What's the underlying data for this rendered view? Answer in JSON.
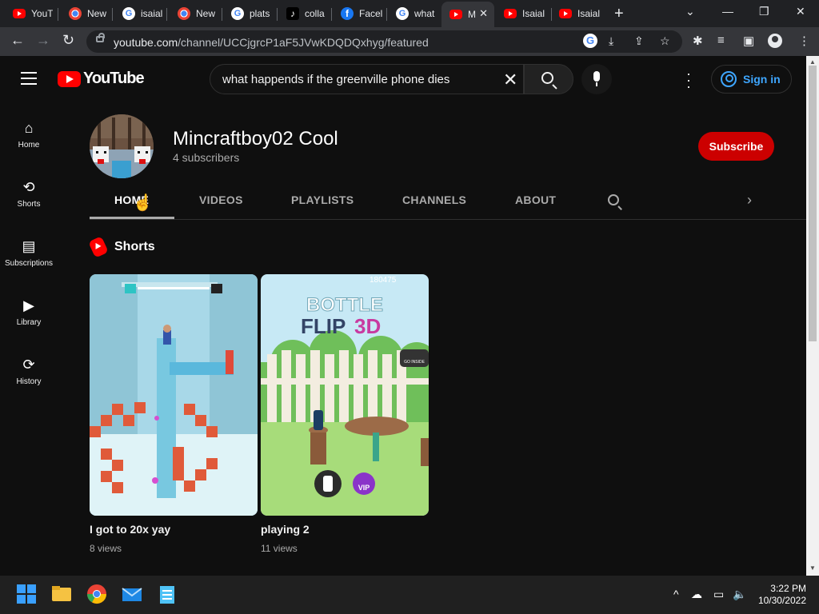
{
  "browser": {
    "tabs": [
      {
        "label": "YouT",
        "icon": "youtube-icon"
      },
      {
        "label": "New",
        "icon": "chrome-icon"
      },
      {
        "label": "isaial",
        "icon": "google-icon"
      },
      {
        "label": "New",
        "icon": "chrome-icon"
      },
      {
        "label": "plats",
        "icon": "google-icon"
      },
      {
        "label": "colla",
        "icon": "tiktok-icon"
      },
      {
        "label": "Facel",
        "icon": "facebook-icon"
      },
      {
        "label": "what",
        "icon": "google-icon"
      },
      {
        "label": "M",
        "icon": "youtube-icon",
        "active": true
      },
      {
        "label": "Isaial",
        "icon": "youtube-icon"
      },
      {
        "label": "Isaial",
        "icon": "youtube-icon"
      }
    ],
    "url_host": "youtube.com",
    "url_path": "/channel/UCCjgrcP1aF5JVwKDQDQxhyg/featured"
  },
  "youtube": {
    "logo_text": "YouTube",
    "search_value": "what happends if the greenville phone dies",
    "signin_label": "Sign in",
    "sidebar": [
      {
        "label": "Home",
        "icon": "home-icon"
      },
      {
        "label": "Shorts",
        "icon": "shorts-icon"
      },
      {
        "label": "Subscriptions",
        "icon": "subscriptions-icon"
      },
      {
        "label": "Library",
        "icon": "library-icon"
      },
      {
        "label": "History",
        "icon": "history-icon"
      }
    ],
    "channel": {
      "name": "Mincraftboy02 Cool",
      "subscribers": "4 subscribers",
      "subscribe_label": "Subscribe",
      "tabs": [
        "HOME",
        "VIDEOS",
        "PLAYLISTS",
        "CHANNELS",
        "ABOUT"
      ]
    },
    "shorts_heading": "Shorts",
    "videos": [
      {
        "title": "I got to 20x yay",
        "views": "8 views"
      },
      {
        "title": "playing 2",
        "views": "11 views",
        "thumb_text_1": "BOTTLE",
        "thumb_text_2": "FLIP",
        "thumb_text_3": "3D",
        "thumb_score": "180475",
        "thumb_badge": "VIP",
        "thumb_home": "GO INSIDE"
      }
    ]
  },
  "taskbar": {
    "time": "3:22 PM",
    "date": "10/30/2022"
  },
  "colors": {
    "yt_bg": "#0f0f0f",
    "subscribe_red": "#cc0000",
    "link_blue": "#3ea6ff",
    "chrome_tab_bg": "#202124"
  }
}
